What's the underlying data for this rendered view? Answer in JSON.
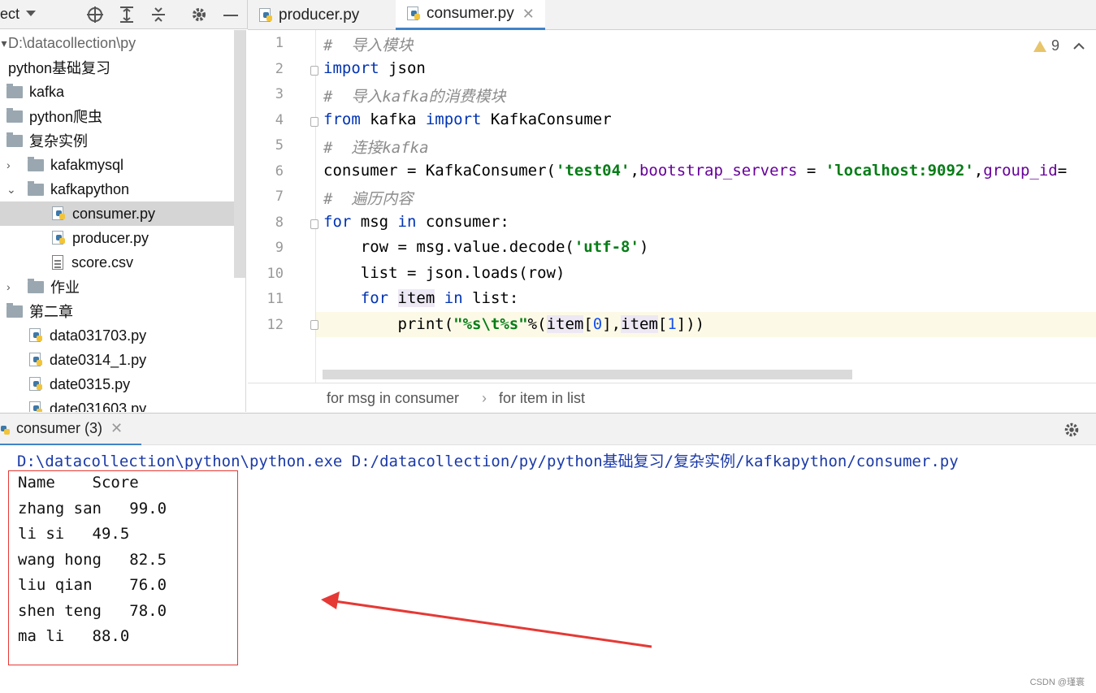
{
  "toolbar": {
    "project_label": "ect"
  },
  "tabs": [
    {
      "label": "producer.py",
      "active": false
    },
    {
      "label": "consumer.py",
      "active": true
    }
  ],
  "tree": {
    "root_path": "D:\\datacollection\\py",
    "items": [
      {
        "label": "python基础复习",
        "kind": "folder"
      },
      {
        "label": "kafka",
        "kind": "folder"
      },
      {
        "label": "python爬虫",
        "kind": "folder"
      },
      {
        "label": "复杂实例",
        "kind": "folder"
      },
      {
        "label": "kafakmysql",
        "kind": "folder"
      },
      {
        "label": "kafkapython",
        "kind": "folder"
      },
      {
        "label": "consumer.py",
        "kind": "py"
      },
      {
        "label": "producer.py",
        "kind": "py"
      },
      {
        "label": "score.csv",
        "kind": "csv"
      },
      {
        "label": "作业",
        "kind": "folder"
      },
      {
        "label": "第二章",
        "kind": "folder"
      },
      {
        "label": "data031703.py",
        "kind": "py"
      },
      {
        "label": "date0314_1.py",
        "kind": "py"
      },
      {
        "label": "date0315.py",
        "kind": "py"
      },
      {
        "label": "date031603.py",
        "kind": "py"
      }
    ]
  },
  "editor": {
    "warning_count": "9",
    "line_numbers": [
      "1",
      "2",
      "3",
      "4",
      "5",
      "6",
      "7",
      "8",
      "9",
      "10",
      "11",
      "12"
    ],
    "lines": {
      "l1": "#  导入模块",
      "l2a": "import",
      "l2b": " json",
      "l3": "#  导入kafka的消费模块",
      "l4a": "from",
      "l4b": " kafka ",
      "l4c": "import",
      "l4d": " KafkaConsumer",
      "l5": "#  连接kafka",
      "l6a": "consumer = KafkaConsumer(",
      "l6b": "'test04'",
      "l6c": ",",
      "l6d": "bootstrap_servers",
      "l6e": " = ",
      "l6f": "'localhost:9092'",
      "l6g": ",",
      "l6h": "group_id",
      "l6i": "=",
      "l7": "#  遍历内容",
      "l8a": "for",
      "l8b": " msg ",
      "l8c": "in",
      "l8d": " consumer:",
      "l9a": "    row = msg.value.decode(",
      "l9b": "'utf-8'",
      "l9c": ")",
      "l10": "    list = json.loads(row)",
      "l11a": "    ",
      "l11b": "for",
      "l11c": " ",
      "l11d": "item",
      "l11e": " ",
      "l11f": "in",
      "l11g": " list:",
      "l12a": "        print(",
      "l12b": "\"%s\\t%s\"",
      "l12c": "%(",
      "l12d": "item",
      "l12e": "[",
      "l12f": "0",
      "l12g": "],",
      "l12h": "item",
      "l12i": "[",
      "l12j": "1",
      "l12k": "]))"
    }
  },
  "breadcrumb": {
    "first": "for msg in consumer",
    "sep": "›",
    "second": "for item in list"
  },
  "run": {
    "tab_label": "consumer (3)",
    "command": "D:\\datacollection\\python\\python.exe D:/datacollection/py/python基础复习/复杂实例/kafkapython/consumer.py",
    "output": [
      "Name    Score",
      "zhang san   99.0",
      "li si   49.5",
      "wang hong   82.5",
      "liu qian    76.0",
      "shen teng   78.0",
      "ma li   88.0"
    ]
  },
  "watermark": "CSDN @瑾寰",
  "colors": {
    "accent": "#4083c9",
    "annotation_red": "#e53935",
    "keyword": "#0033b3",
    "string": "#067d17"
  }
}
